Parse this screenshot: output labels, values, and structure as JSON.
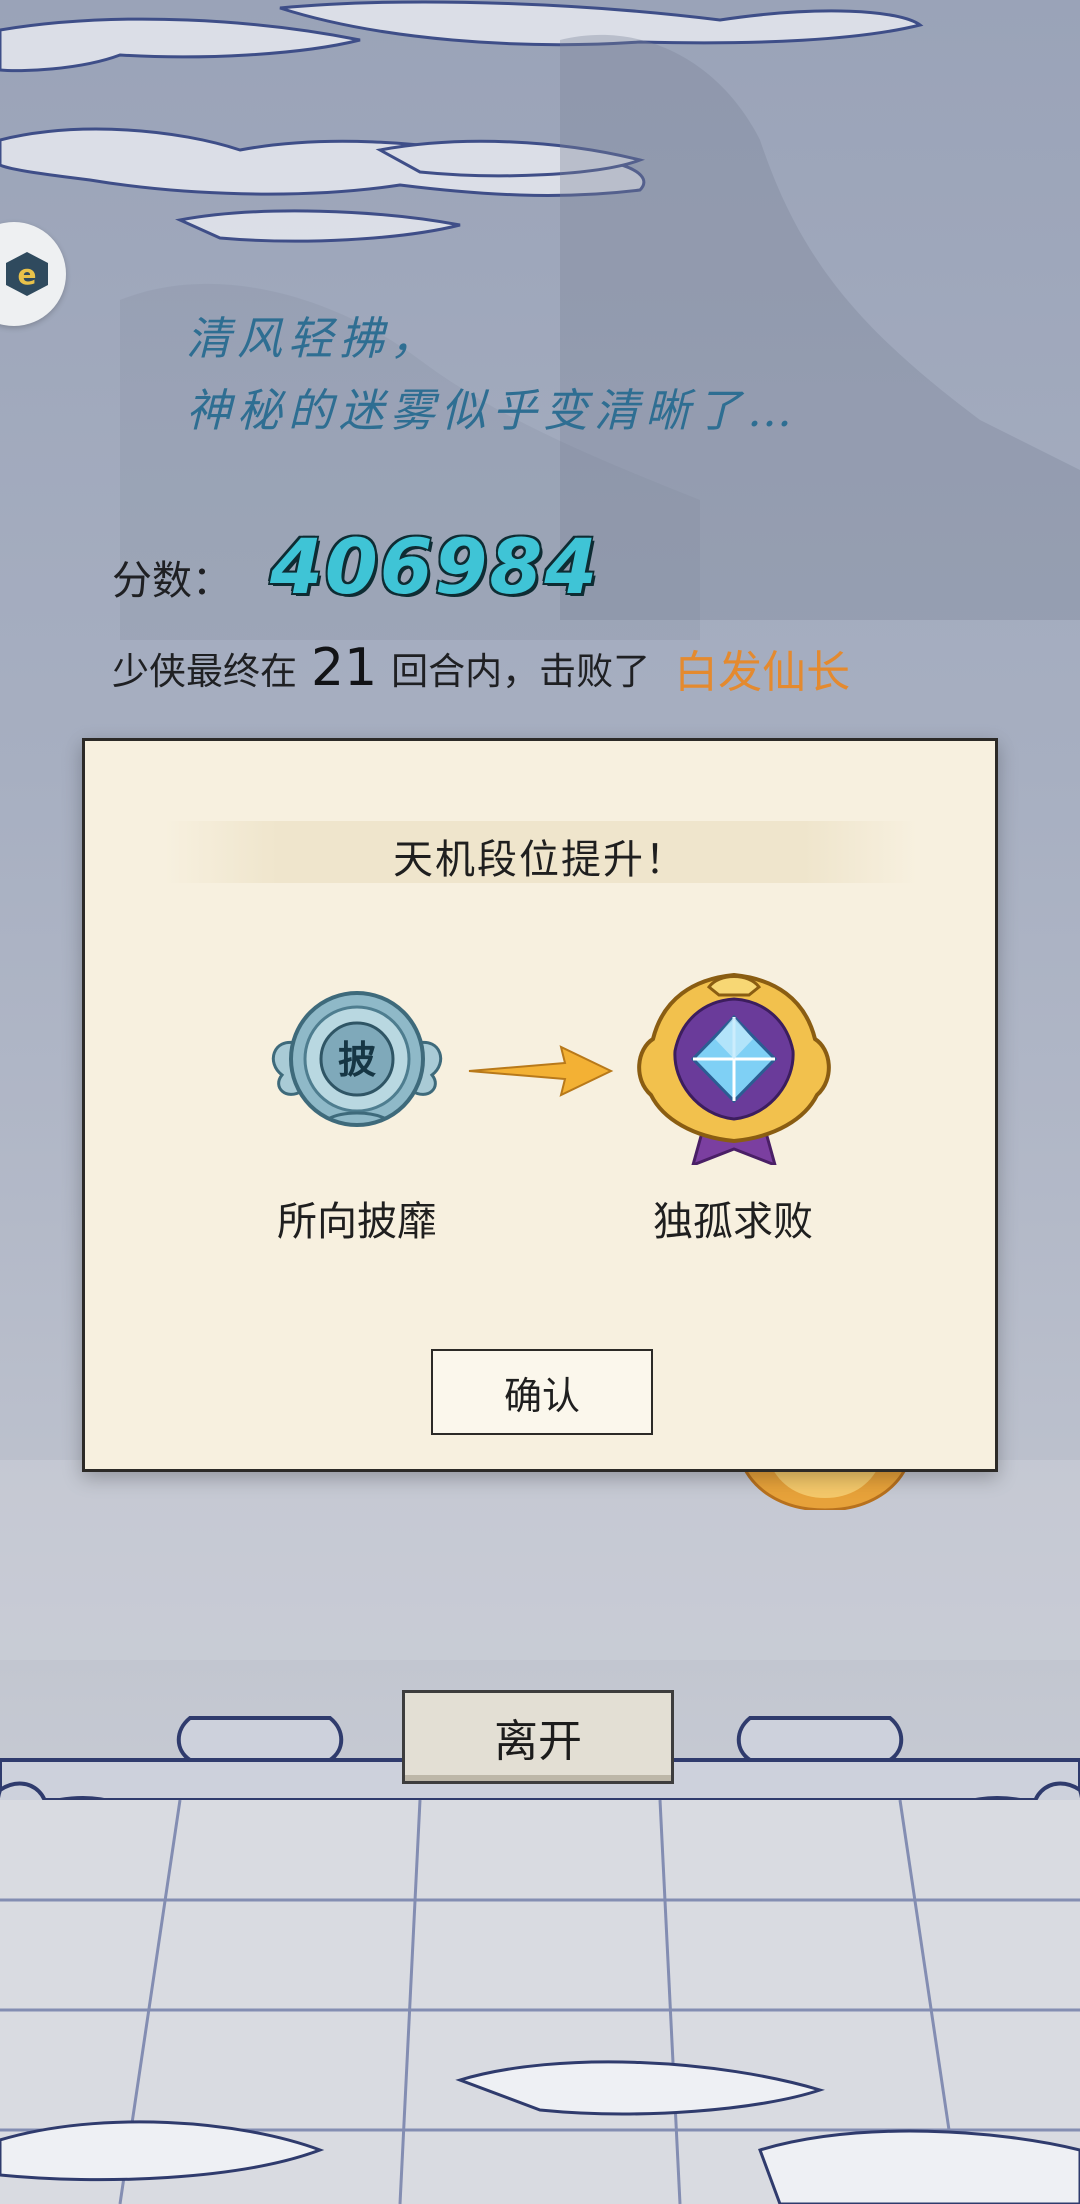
{
  "poem": {
    "line1": "清风轻拂，",
    "line2": "神秘的迷雾似乎变清晰了…"
  },
  "score": {
    "label": "分数：",
    "value": "406984"
  },
  "result": {
    "prefix": "少侠最终在",
    "rounds": "21",
    "middle": "回合内，击败了",
    "boss": "白发仙长"
  },
  "dialog": {
    "title": "天机段位提升！",
    "old_rank": {
      "glyph": "披",
      "name": "所向披靡"
    },
    "new_rank": {
      "name": "独孤求败"
    },
    "confirm_label": "确认"
  },
  "leave_label": "离开",
  "colors": {
    "score": "#3fc4d6",
    "boss": "#e48a2f",
    "poem": "#2e6e92",
    "dialog_bg": "#f7f0df"
  },
  "icons": {
    "side_badge": "app-badge-icon",
    "old_rank": "silver-rank-medal-icon",
    "arrow": "arrow-right-icon",
    "new_rank": "gold-diamond-rank-medal-icon"
  }
}
